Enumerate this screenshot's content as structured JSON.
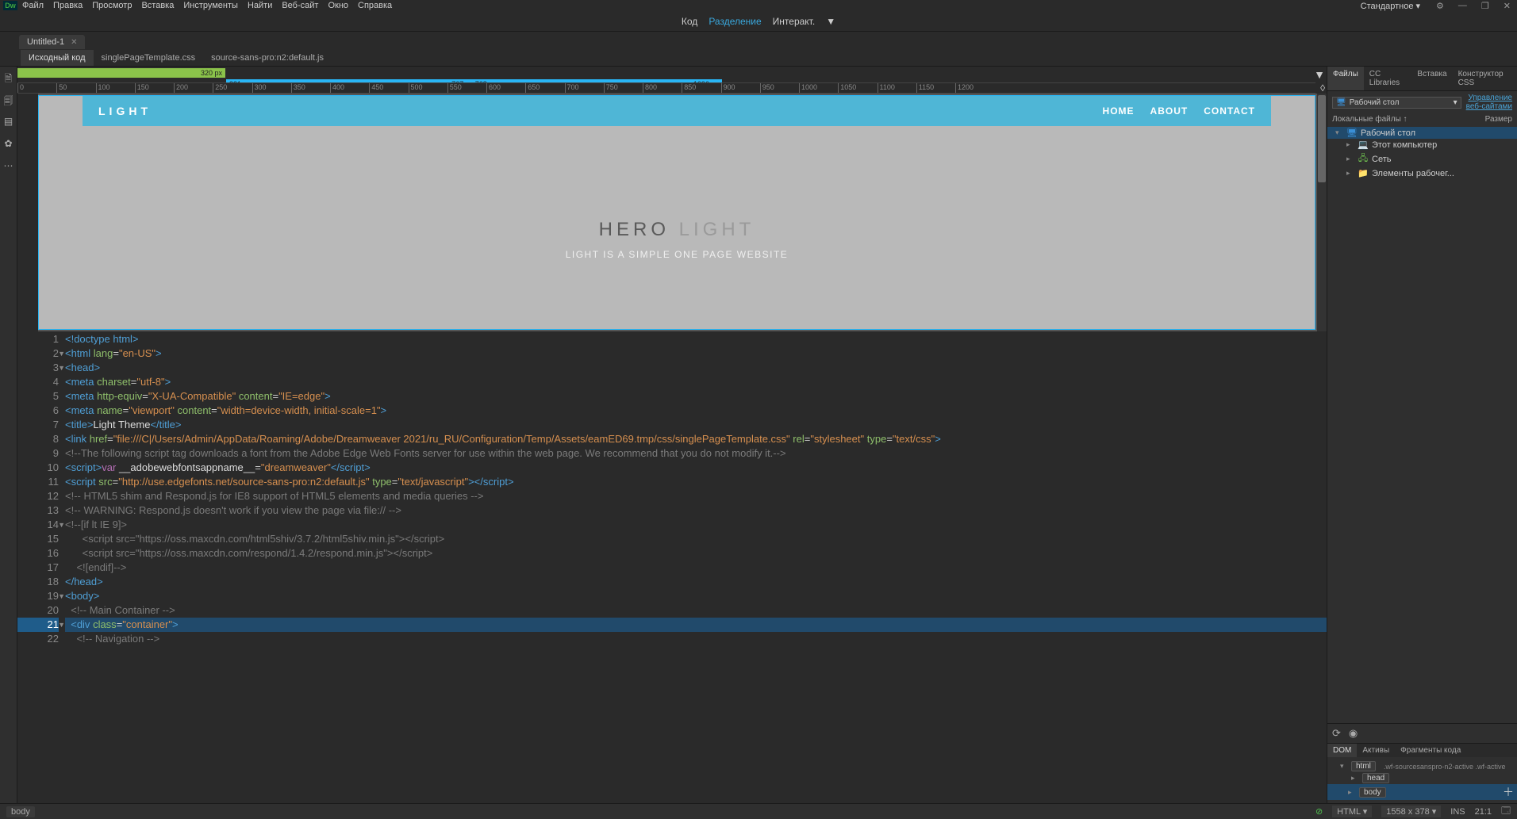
{
  "menubar": {
    "logo": "Dw",
    "items": [
      "Файл",
      "Правка",
      "Просмотр",
      "Вставка",
      "Инструменты",
      "Найти",
      "Веб-сайт",
      "Окно",
      "Справка"
    ],
    "workspace": "Стандартное"
  },
  "viewbar": {
    "code": "Код",
    "split": "Разделение",
    "live": "Интеракт."
  },
  "doctab": {
    "title": "Untitled-1"
  },
  "srctabs": {
    "items": [
      "Исходный код",
      "singlePageTemplate.css",
      "source-sans-pro:n2:default.js"
    ],
    "active": 0
  },
  "mediaqueries": {
    "green_label": "320 px",
    "blue_left": "321 px",
    "blue_center": "767 px   768 px",
    "blue_right": "1096 px"
  },
  "ruler_ticks": [
    0,
    50,
    100,
    150,
    200,
    250,
    300,
    350,
    400,
    450,
    500,
    550,
    600,
    650,
    700,
    750,
    800,
    850,
    900,
    950,
    1000,
    1050,
    1100,
    1150,
    1200
  ],
  "preview": {
    "logo": "LIGHT",
    "nav": [
      "HOME",
      "ABOUT",
      "CONTACT"
    ],
    "hero_bold": "HERO",
    "hero_light": "LIGHT",
    "hero_sub": "LIGHT IS A SIMPLE ONE PAGE WEBSITE"
  },
  "code_lines": [
    {
      "n": 1,
      "fold": "",
      "html": "<span class='c-tag'>&lt;!doctype html&gt;</span>"
    },
    {
      "n": 2,
      "fold": "▼",
      "html": "<span class='c-tag'>&lt;html</span> <span class='c-attr'>lang</span>=<span class='c-str'>\"en-US\"</span><span class='c-tag'>&gt;</span>"
    },
    {
      "n": 3,
      "fold": "▼",
      "html": "<span class='c-tag'>&lt;head&gt;</span>"
    },
    {
      "n": 4,
      "fold": "",
      "html": "<span class='c-tag'>&lt;meta</span> <span class='c-attr'>charset</span>=<span class='c-str'>\"utf-8\"</span><span class='c-tag'>&gt;</span>"
    },
    {
      "n": 5,
      "fold": "",
      "html": "<span class='c-tag'>&lt;meta</span> <span class='c-attr'>http-equiv</span>=<span class='c-str'>\"X-UA-Compatible\"</span> <span class='c-attr'>content</span>=<span class='c-str'>\"IE=edge\"</span><span class='c-tag'>&gt;</span>"
    },
    {
      "n": 6,
      "fold": "",
      "html": "<span class='c-tag'>&lt;meta</span> <span class='c-attr'>name</span>=<span class='c-str'>\"viewport\"</span> <span class='c-attr'>content</span>=<span class='c-str'>\"width=device-width, initial-scale=1\"</span><span class='c-tag'>&gt;</span>"
    },
    {
      "n": 7,
      "fold": "",
      "html": "<span class='c-tag'>&lt;title&gt;</span><span class='c-txt'>Light Theme</span><span class='c-tag'>&lt;/title&gt;</span>"
    },
    {
      "n": 8,
      "fold": "",
      "html": "<span class='c-tag'>&lt;link</span> <span class='c-attr'>href</span>=<span class='c-str'>\"file:///C|/Users/Admin/AppData/Roaming/Adobe/Dreamweaver 2021/ru_RU/Configuration/Temp/Assets/eamED69.tmp/css/singlePageTemplate.css\"</span> <span class='c-attr'>rel</span>=<span class='c-str'>\"stylesheet\"</span> <span class='c-attr'>type</span>=<span class='c-str'>\"text/css\"</span><span class='c-tag'>&gt;</span>"
    },
    {
      "n": 9,
      "fold": "",
      "html": "<span class='c-com'>&lt;!--The following script tag downloads a font from the Adobe Edge Web Fonts server for use within the web page. We recommend that you do not modify it.--&gt;</span>"
    },
    {
      "n": 10,
      "fold": "",
      "html": "<span class='c-tag'>&lt;script&gt;</span><span class='c-key'>var</span> <span class='c-txt'>__adobewebfontsappname__</span>=<span class='c-str'>\"dreamweaver\"</span><span class='c-tag'>&lt;/script&gt;</span>"
    },
    {
      "n": 11,
      "fold": "",
      "html": "<span class='c-tag'>&lt;script</span> <span class='c-attr'>src</span>=<span class='c-str'>\"http://use.edgefonts.net/source-sans-pro:n2:default.js\"</span> <span class='c-attr'>type</span>=<span class='c-str'>\"text/javascript\"</span><span class='c-tag'>&gt;&lt;/script&gt;</span>"
    },
    {
      "n": 12,
      "fold": "",
      "html": "<span class='c-com'>&lt;!-- HTML5 shim and Respond.js for IE8 support of HTML5 elements and media queries --&gt;</span>"
    },
    {
      "n": 13,
      "fold": "",
      "html": "<span class='c-com'>&lt;!-- WARNING: Respond.js doesn't work if you view the page via file:// --&gt;</span>"
    },
    {
      "n": 14,
      "fold": "▼",
      "html": "<span class='c-com'>&lt;!--[if lt IE 9]&gt;</span>"
    },
    {
      "n": 15,
      "fold": "",
      "html": "<span class='c-com'>      &lt;script src=\"https://oss.maxcdn.com/html5shiv/3.7.2/html5shiv.min.js\"&gt;&lt;/script&gt;</span>"
    },
    {
      "n": 16,
      "fold": "",
      "html": "<span class='c-com'>      &lt;script src=\"https://oss.maxcdn.com/respond/1.4.2/respond.min.js\"&gt;&lt;/script&gt;</span>"
    },
    {
      "n": 17,
      "fold": "",
      "html": "<span class='c-com'>    &lt;![endif]--&gt;</span>"
    },
    {
      "n": 18,
      "fold": "",
      "html": "<span class='c-tag'>&lt;/head&gt;</span>"
    },
    {
      "n": 19,
      "fold": "▼",
      "html": "<span class='c-tag'>&lt;body&gt;</span>"
    },
    {
      "n": 20,
      "fold": "",
      "html": "<span class='c-com'>  &lt;!-- Main Container --&gt;</span>"
    },
    {
      "n": 21,
      "fold": "▼",
      "hl": true,
      "html": "<span class='c-tag'>  &lt;div</span> <span class='c-attr'>class</span>=<span class='c-str'>\"container\"</span><span class='c-tag'>&gt;</span>"
    },
    {
      "n": 22,
      "fold": "",
      "html": "<span class='c-com'>    &lt;!-- Navigation --&gt;</span>"
    }
  ],
  "files_panel": {
    "tabs": [
      "Файлы",
      "CC Libraries",
      "Вставка",
      "Конструктор CSS"
    ],
    "active": 0,
    "combo": "Рабочий стол",
    "link1": "Управление",
    "link2": "веб-сайтами",
    "col_local": "Локальные файлы ↑",
    "col_size": "Размер",
    "tree": [
      {
        "depth": 0,
        "icon": "desktop",
        "label": "Рабочий стол",
        "sel": true,
        "exp": "▾"
      },
      {
        "depth": 1,
        "icon": "pc",
        "label": "Этот компьютер",
        "exp": "▸"
      },
      {
        "depth": 1,
        "icon": "net",
        "label": "Сеть",
        "exp": "▸"
      },
      {
        "depth": 1,
        "icon": "folder",
        "label": "Элементы рабочег...",
        "exp": "▸"
      }
    ]
  },
  "dom_panel": {
    "tabs": [
      "DOM",
      "Активы",
      "Фрагменты кода"
    ],
    "active": 0,
    "rows": [
      {
        "depth": 0,
        "tag": "html",
        "cls": ".wf-sourcesanspro-n2-active .wf-active",
        "exp": "▾"
      },
      {
        "depth": 1,
        "tag": "head",
        "exp": "▸"
      },
      {
        "depth": 1,
        "tag": "body",
        "exp": "▸",
        "sel": true
      }
    ]
  },
  "statusbar": {
    "crumb": "body",
    "lang": "HTML",
    "dims": "1558 x 378",
    "ins": "INS",
    "pos": "21:1"
  }
}
